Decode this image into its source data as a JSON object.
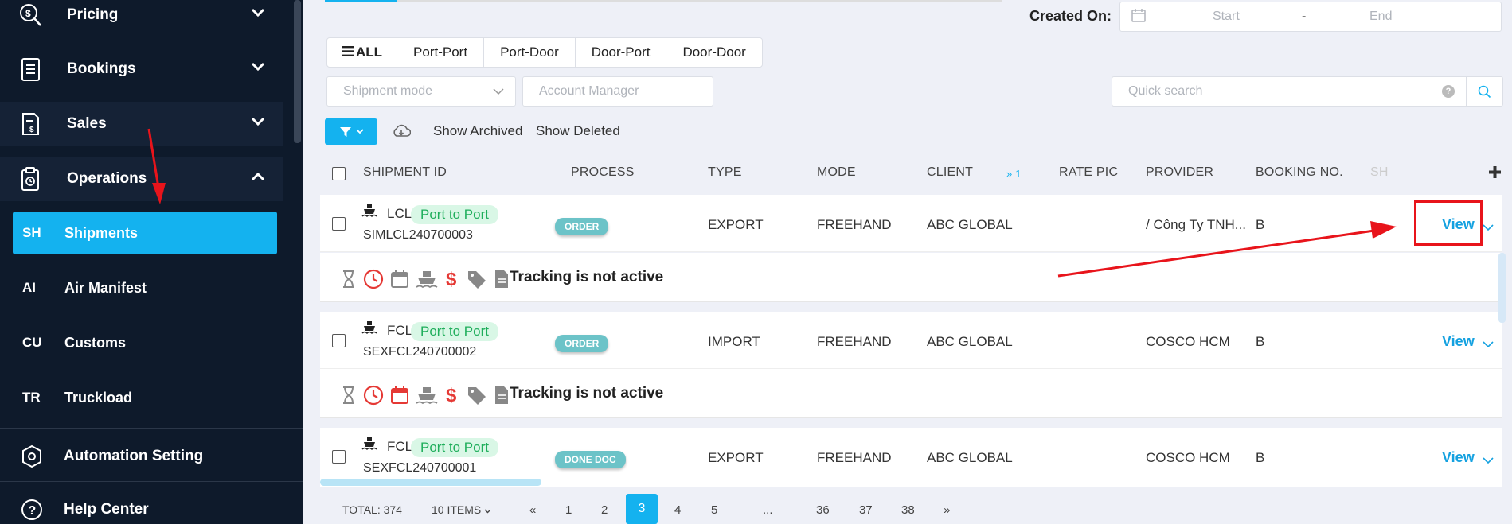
{
  "sidebar": {
    "items": [
      {
        "label": "Pricing",
        "icon": "pricing-icon"
      },
      {
        "label": "Bookings",
        "icon": "bookings-icon"
      },
      {
        "label": "Sales",
        "icon": "sales-icon"
      },
      {
        "label": "Operations",
        "icon": "operations-icon"
      }
    ],
    "sub_items": [
      {
        "abbr": "SH",
        "label": "Shipments"
      },
      {
        "abbr": "AI",
        "label": "Air Manifest"
      },
      {
        "abbr": "CU",
        "label": "Customs"
      },
      {
        "abbr": "TR",
        "label": "Truckload"
      }
    ],
    "automation": "Automation Setting",
    "help": "Help Center"
  },
  "filters": {
    "created_label": "Created On:",
    "date_start": "Start",
    "date_sep": "-",
    "date_end": "End",
    "segments": [
      "ALL",
      "Port-Port",
      "Port-Door",
      "Door-Port",
      "Door-Door"
    ],
    "shipment_mode_placeholder": "Shipment mode",
    "account_manager_placeholder": "Account Manager",
    "quick_search_placeholder": "Quick search",
    "show_archived": "Show Archived",
    "show_deleted": "Show Deleted"
  },
  "table": {
    "headers": [
      "SHIPMENT ID",
      "PROCESS",
      "TYPE",
      "MODE",
      "CLIENT",
      "RATE PIC",
      "PROVIDER",
      "BOOKING NO.",
      "SH"
    ],
    "client_sort_count": "1",
    "rows": [
      {
        "mode_type": "LCL",
        "route": "Port to Port",
        "id": "SIMLCL240700003",
        "process": "ORDER",
        "type": "EXPORT",
        "mode": "FREEHAND",
        "client": "ABC GLOBAL",
        "provider": "/ Công Ty TNH...",
        "booking": "B",
        "view": "View",
        "tracking": "Tracking is not active"
      },
      {
        "mode_type": "FCL",
        "route": "Port to Port",
        "id": "SEXFCL240700002",
        "process": "ORDER",
        "type": "IMPORT",
        "mode": "FREEHAND",
        "client": "ABC GLOBAL",
        "provider": "COSCO HCM",
        "booking": "B",
        "view": "View",
        "tracking": "Tracking is not active"
      },
      {
        "mode_type": "FCL",
        "route": "Port to Port",
        "id": "SEXFCL240700001",
        "process": "DONE DOC",
        "type": "EXPORT",
        "mode": "FREEHAND",
        "client": "ABC GLOBAL",
        "provider": "COSCO HCM",
        "booking": "B",
        "view": "View"
      }
    ]
  },
  "pagination": {
    "total": "TOTAL: 374",
    "page_size": "10 ITEMS",
    "prev": "«",
    "next": "»",
    "pages": [
      "1",
      "2",
      "3",
      "4",
      "5",
      "...",
      "36",
      "37",
      "38"
    ],
    "current": "3"
  },
  "colors": {
    "accent": "#14b2ef",
    "sidebar_bg": "#0e1a2b",
    "annotation": "#e8141b"
  }
}
